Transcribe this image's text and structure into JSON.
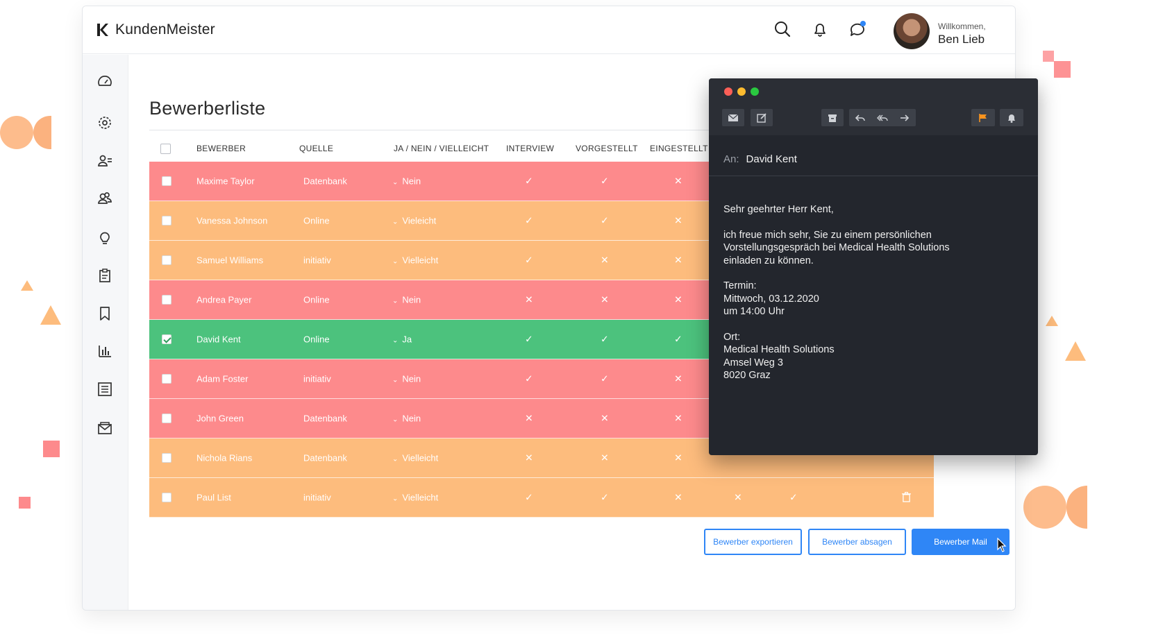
{
  "app": {
    "logo": "KundenMeister",
    "welcome": "Willkommen,",
    "user_name": "Ben Lieb"
  },
  "page": {
    "title": "Bewerberliste"
  },
  "table": {
    "columns": [
      "BEWERBER",
      "QUELLE",
      "JA / NEIN / VIELLEICHT",
      "INTERVIEW",
      "VORGESTELLT",
      "EINGESTELLT"
    ],
    "rows": [
      {
        "name": "Maxime Taylor",
        "source": "Datenbank",
        "decision": "Nein",
        "interview": "✓",
        "vorgestellt": "✓",
        "eingestellt": "✕",
        "color": "red",
        "checked": false
      },
      {
        "name": "Vanessa Johnson",
        "source": "Online",
        "decision": "Vieleicht",
        "interview": "✓",
        "vorgestellt": "✓",
        "eingestellt": "✕",
        "color": "orange",
        "checked": false
      },
      {
        "name": "Samuel Williams",
        "source": "initiativ",
        "decision": "Vielleicht",
        "interview": "✓",
        "vorgestellt": "✕",
        "eingestellt": "✕",
        "color": "orange",
        "checked": false
      },
      {
        "name": "Andrea Payer",
        "source": "Online",
        "decision": "Nein",
        "interview": "✕",
        "vorgestellt": "✕",
        "eingestellt": "✕",
        "color": "red",
        "checked": false
      },
      {
        "name": "David Kent",
        "source": "Online",
        "decision": "Ja",
        "interview": "✓",
        "vorgestellt": "✓",
        "eingestellt": "✓",
        "color": "green",
        "checked": true
      },
      {
        "name": "Adam Foster",
        "source": "initiativ",
        "decision": "Nein",
        "interview": "✓",
        "vorgestellt": "✓",
        "eingestellt": "✕",
        "color": "red",
        "checked": false
      },
      {
        "name": "John Green",
        "source": "Datenbank",
        "decision": "Nein",
        "interview": "✕",
        "vorgestellt": "✕",
        "eingestellt": "✕",
        "color": "red",
        "checked": false
      },
      {
        "name": "Nichola Rians",
        "source": "Datenbank",
        "decision": "Vielleicht",
        "interview": "✕",
        "vorgestellt": "✕",
        "eingestellt": "✕",
        "color": "orange",
        "checked": false
      },
      {
        "name": "Paul List",
        "source": "initiativ",
        "decision": "Vielleicht",
        "interview": "✓",
        "vorgestellt": "✓",
        "eingestellt": "✕",
        "extra1": "✕",
        "extra2": "✓",
        "color": "orange",
        "checked": false
      }
    ]
  },
  "actions": {
    "export": "Bewerber exportieren",
    "reject": "Bewerber absagen",
    "mail": "Bewerber Mail"
  },
  "mail": {
    "to_label": "An:",
    "to": "David Kent",
    "greeting": "Sehr geehrter Herr Kent,",
    "paragraph": "ich freue mich sehr, Sie zu einem persönlichen\nVorstellungsgespräch bei Medical Health Solutions\neinladen zu können.",
    "termin_label": "Termin:",
    "termin_date": "Mittwoch, 03.12.2020",
    "termin_time": "um 14:00 Uhr",
    "ort_label": "Ort:",
    "ort_name": "Medical Health Solutions",
    "ort_street": "Amsel Weg 3",
    "ort_city": "8020 Graz"
  },
  "colors": {
    "red_row": "#fd8a8c",
    "orange_row": "#fdbc7d",
    "green_row": "#4cc27d",
    "accent": "#2f86f6",
    "mail_bg": "#23262d"
  }
}
